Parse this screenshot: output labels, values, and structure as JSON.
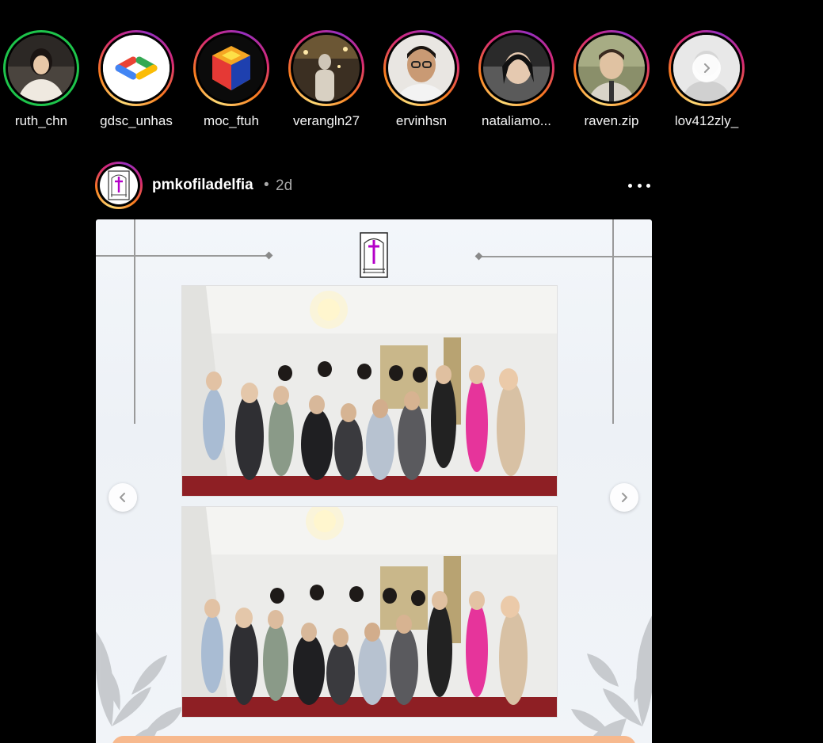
{
  "stories": [
    {
      "username": "ruth_chn",
      "ring": "close-friends"
    },
    {
      "username": "gdsc_unhas",
      "ring": "gradient"
    },
    {
      "username": "moc_ftuh",
      "ring": "gradient"
    },
    {
      "username": "verangln27",
      "ring": "gradient"
    },
    {
      "username": "ervinhsn",
      "ring": "gradient"
    },
    {
      "username": "nataliamo...",
      "ring": "gradient"
    },
    {
      "username": "raven.zip",
      "ring": "gradient"
    },
    {
      "username": "lov412zly_",
      "ring": "gradient"
    }
  ],
  "post": {
    "username": "pmkofiladelfia",
    "separator": "•",
    "time": "2d",
    "more_icon": "more-horizontal-icon",
    "carousel": {
      "prev_icon": "chevron-left-icon",
      "next_icon": "chevron-right-icon"
    }
  },
  "colors": {
    "background": "#000000",
    "story_gradient": [
      "#feda75",
      "#fa7e1e",
      "#d62976",
      "#962fbf"
    ],
    "close_friends_ring": "#1ec44b",
    "muted_text": "#a8a8a8"
  }
}
